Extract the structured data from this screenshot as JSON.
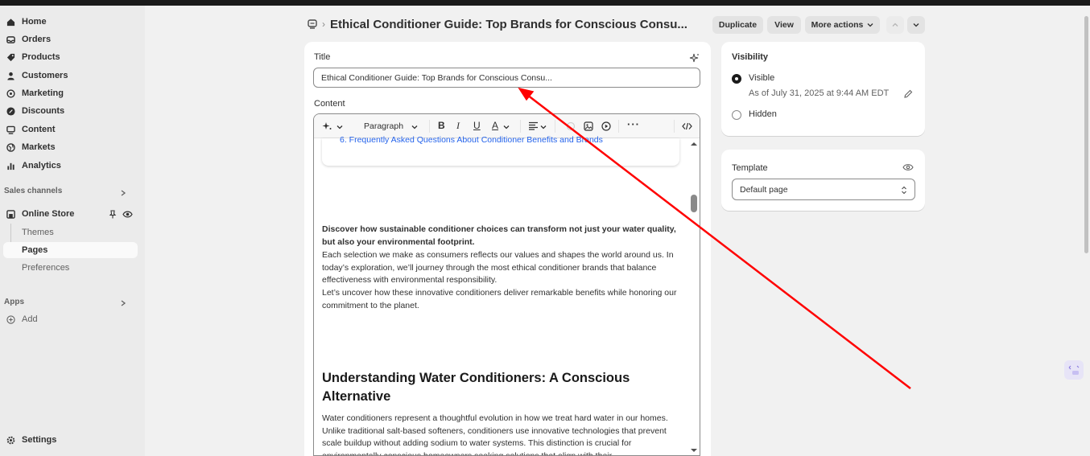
{
  "sidebar": {
    "items": [
      {
        "label": "Home",
        "icon": "home-icon"
      },
      {
        "label": "Orders",
        "icon": "inbox-icon"
      },
      {
        "label": "Products",
        "icon": "tag-icon"
      },
      {
        "label": "Customers",
        "icon": "person-icon"
      },
      {
        "label": "Marketing",
        "icon": "target-icon"
      },
      {
        "label": "Discounts",
        "icon": "discount-icon"
      },
      {
        "label": "Content",
        "icon": "content-icon"
      },
      {
        "label": "Markets",
        "icon": "globe-icon"
      },
      {
        "label": "Analytics",
        "icon": "bar-chart-icon"
      }
    ],
    "sales_channels_label": "Sales channels",
    "online_store": {
      "label": "Online Store",
      "icon": "store-icon"
    },
    "store_subitems": [
      "Themes",
      "Pages",
      "Preferences"
    ],
    "apps_label": "Apps",
    "add_label": "Add",
    "settings_label": "Settings"
  },
  "header": {
    "breadcrumb_icon": "page-icon",
    "title": "Ethical Conditioner Guide: Top Brands for Conscious Consu...",
    "buttons": {
      "duplicate": "Duplicate",
      "view": "View",
      "more_actions": "More actions"
    }
  },
  "form": {
    "title_label": "Title",
    "title_value": "Ethical Conditioner Guide: Top Brands for Conscious Consu...",
    "content_label": "Content",
    "toolbar": {
      "paragraph": "Paragraph"
    },
    "toc_item": "6. Frequently Asked Questions About Conditioner Benefits and Brands",
    "intro_bold": "Discover how sustainable conditioner choices can transform not just your water quality, but also your environmental footprint.",
    "intro_paragraph": "Each selection we make as consumers reflects our values and shapes the world around us. In today’s exploration, we’ll journey through the most ethical conditioner brands that balance effectiveness with environmental responsibility.",
    "intro_paragraph2": "Let’s uncover how these innovative conditioners deliver remarkable benefits while honoring our commitment to the planet.",
    "heading": "Understanding Water Conditioners: A Conscious Alternative",
    "body": "Water conditioners represent a thoughtful evolution in how we treat hard water in our homes. Unlike traditional salt-based softeners, conditioners use innovative technologies that prevent scale buildup without adding sodium to water systems. This distinction is crucial for environmentally conscious homeowners seeking solutions that align with their"
  },
  "visibility": {
    "title": "Visibility",
    "visible_label": "Visible",
    "visible_date": "As of July 31, 2025 at 9:44 AM EDT",
    "hidden_label": "Hidden"
  },
  "template": {
    "title": "Template",
    "value": "Default page"
  },
  "colors": {
    "arrow": "#ff0000",
    "link": "#2463eb"
  }
}
